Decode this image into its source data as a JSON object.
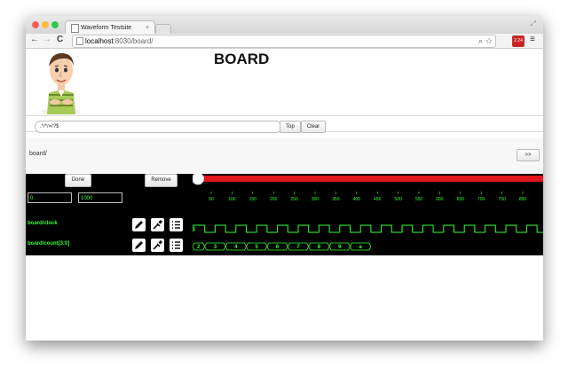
{
  "browser": {
    "tab_title": "Waveform Testsite",
    "tab_close": "×",
    "url_host": "localhost",
    "url_rest": ":8030/board/",
    "back": "←",
    "forward": "→",
    "reload": "C",
    "menu": "≡",
    "extension_badge": "2.24"
  },
  "page": {
    "title": "BOARD",
    "filter_value": ".*/*/=/?$",
    "top_label": "Top",
    "clear_label": "Clear",
    "breadcrumb": "board/",
    "next_label": ">>"
  },
  "viewer": {
    "done_label": "Done",
    "remove_label": "Remove",
    "start_value": "0",
    "end_value": "1000",
    "slider_position": 0.0,
    "slider_color": "#e0161b",
    "wave_color": "#33ff33",
    "ticks": [
      "50",
      "100",
      "150",
      "200",
      "250",
      "300",
      "350",
      "400",
      "450",
      "500",
      "550",
      "600",
      "650",
      "700",
      "750",
      "800"
    ],
    "signals": [
      {
        "name": "board/clock",
        "start_label": "1"
      },
      {
        "name": "board/count[3:0]",
        "values": [
          "2",
          "3",
          "4",
          "5",
          "6",
          "7",
          "8",
          "9",
          "a"
        ]
      }
    ]
  }
}
